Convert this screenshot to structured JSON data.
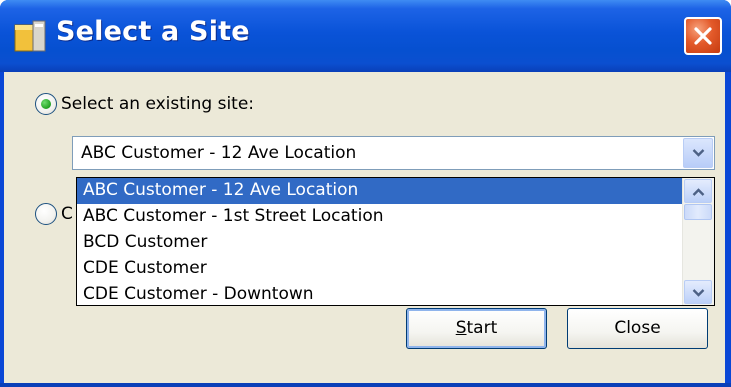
{
  "window": {
    "title": "Select a Site",
    "colors": {
      "titlebar": "#0a53d8",
      "body": "#ece9d8",
      "selection": "#316ac5",
      "close_button": "#e35a2a"
    },
    "icons": {
      "app": "app-window-icon",
      "close": "close-icon"
    }
  },
  "options": {
    "existing_label": "Select an existing site:",
    "existing_selected": true,
    "second_selected": false,
    "second_label_visible_fragment": "C"
  },
  "combo": {
    "value": "ABC Customer - 12 Ave Location",
    "arrow_icon": "chevron-down-icon"
  },
  "dropdown": {
    "items": [
      "ABC Customer - 12 Ave Location",
      "ABC Customer - 1st Street Location",
      "BCD Customer",
      "CDE Customer",
      "CDE Customer - Downtown"
    ],
    "selected_index": 0,
    "scroll_up_icon": "scroll-up-icon",
    "scroll_down_icon": "scroll-down-icon"
  },
  "buttons": {
    "start_prefix": "S",
    "start_rest": "tart",
    "close": "Close"
  }
}
